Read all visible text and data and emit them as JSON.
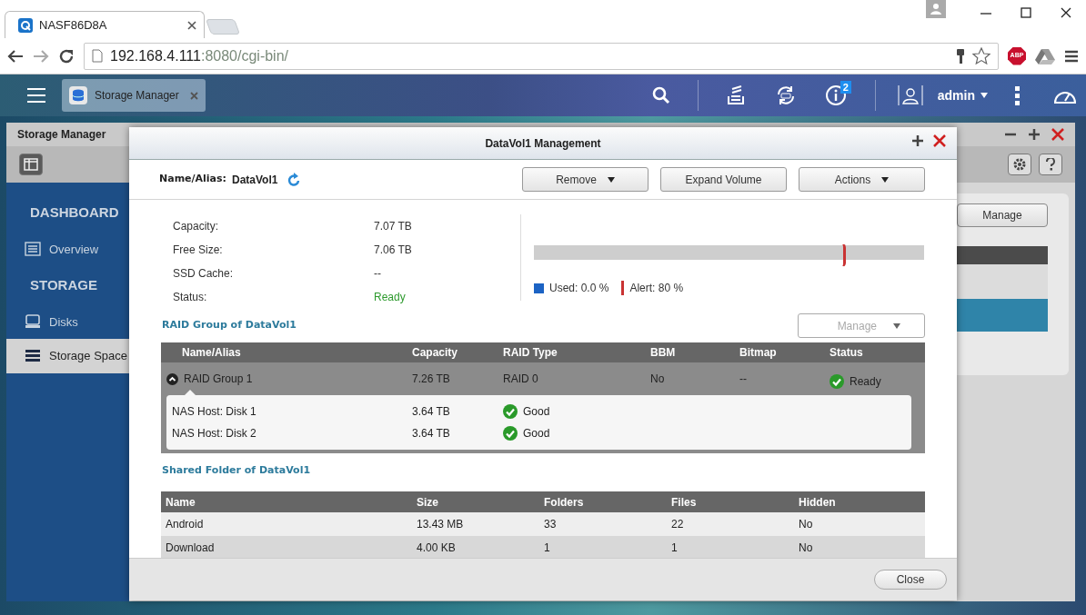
{
  "browser": {
    "tabs": [
      {
        "title": "NASF86D8A",
        "selected": true
      }
    ],
    "url": {
      "host": "192.168.4.111",
      "path": ":8080/cgi-bin/"
    },
    "extension_label": "ABP"
  },
  "taskbar": {
    "app_tabs": [
      {
        "label": "Storage Manager",
        "selected": true
      }
    ],
    "notification_count": "2",
    "user": "admin"
  },
  "app_window": {
    "title": "Storage Manager",
    "sidebar": [
      {
        "heading": "DASHBOARD",
        "items": [
          {
            "label": "Overview",
            "kind": "list",
            "selected": false
          }
        ]
      },
      {
        "heading": "STORAGE",
        "items": [
          {
            "label": "Disks",
            "kind": "disk",
            "selected": false
          },
          {
            "label": "Storage Space",
            "kind": "stack",
            "selected": true
          }
        ]
      }
    ],
    "manage_button": "Manage",
    "volume_rows": [
      {
        "selected": false
      },
      {
        "selected": true
      }
    ]
  },
  "dialog": {
    "title": "DataVol1 Management",
    "name_label": "Name/Alias:",
    "name_value": "DataVol1",
    "buttons": [
      {
        "label": "Remove",
        "dropdown": true
      },
      {
        "label": "Expand Volume",
        "dropdown": false
      },
      {
        "label": "Actions",
        "dropdown": true
      }
    ],
    "info": [
      {
        "label": "Capacity:",
        "value": "7.07 TB",
        "kind": "plain"
      },
      {
        "label": "Free Size:",
        "value": "7.06 TB",
        "kind": "plain"
      },
      {
        "label": "SSD Cache:",
        "value": "--",
        "kind": "plain"
      },
      {
        "label": "Status:",
        "value": "Ready",
        "kind": "status"
      }
    ],
    "usage": {
      "used": {
        "label": "Used: 0.0 %"
      },
      "alert": {
        "label": "Alert: 80 %",
        "level": 0.8
      }
    },
    "raid": {
      "heading": "RAID Group of DataVol1",
      "manage": {
        "label": "Manage",
        "disabled": true
      },
      "columns": [
        "Name/Alias",
        "Capacity",
        "RAID Type",
        "BBM",
        "Bitmap",
        "Status"
      ],
      "groups": [
        {
          "cells": [
            "RAID Group 1",
            "7.26 TB",
            "RAID 0",
            "No",
            "--"
          ],
          "status": "Ready",
          "expanded": true,
          "disks": [
            {
              "name": "NAS Host: Disk 1",
              "capacity": "3.64 TB",
              "status": "Good"
            },
            {
              "name": "NAS Host: Disk 2",
              "capacity": "3.64 TB",
              "status": "Good"
            }
          ]
        }
      ]
    },
    "shared": {
      "heading": "Shared Folder of DataVol1",
      "columns": [
        "Name",
        "Size",
        "Folders",
        "Files",
        "Hidden"
      ],
      "rows": [
        {
          "cells": [
            "Android",
            "13.43 MB",
            "33",
            "22",
            "No"
          ]
        },
        {
          "cells": [
            "Download",
            "4.00 KB",
            "1",
            "1",
            "No"
          ]
        }
      ]
    },
    "close": "Close"
  }
}
